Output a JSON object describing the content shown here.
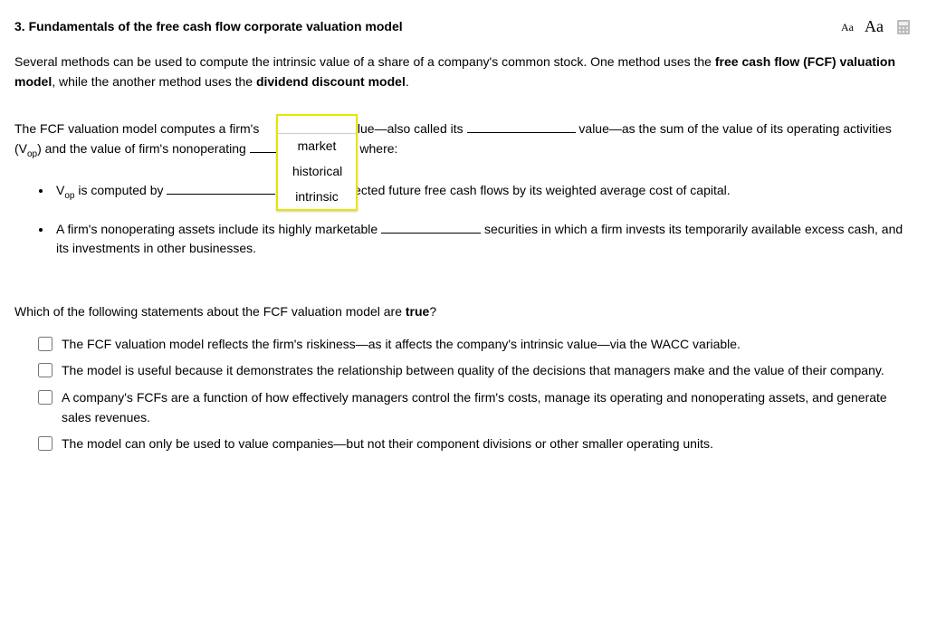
{
  "header": {
    "title": "3.  Fundamentals of the free cash flow corporate valuation model",
    "font_small": "Aa",
    "font_large": "Aa"
  },
  "intro": {
    "pre": "Several methods can be used to compute the intrinsic value of a share of a company's common stock. One method uses the ",
    "bold1": "free cash flow (FCF) valuation model",
    "mid": ", while the another method uses the ",
    "bold2": "dividend discount model",
    "post": "."
  },
  "para": {
    "seg1": "The FCF valuation model computes a firm's ",
    "seg2": " value—also called its ",
    "seg3": " value—as the sum of the value of its operating activities (V",
    "seg3_sub": "op",
    "seg3b": ") and the value of firm's nonoperating ",
    "seg4": " , where:"
  },
  "dropdown": {
    "options": [
      "market",
      "historical",
      "intrinsic"
    ]
  },
  "bullets": {
    "b1_a": "V",
    "b1_sub": "op",
    "b1_b": " is computed by ",
    "b1_c": " the firm's expected future free cash flows by its weighted average cost of capital.",
    "b2_a": "A firm's nonoperating assets include its highly marketable ",
    "b2_b": " securities in which a firm invests its temporarily available excess cash, and its investments in other businesses."
  },
  "q2": {
    "pre": "Which of the following statements about the FCF valuation model are ",
    "bold": "true",
    "post": "?"
  },
  "options": [
    "The FCF valuation model reflects the firm's riskiness—as it affects the company's intrinsic value—via the WACC variable.",
    "The model is useful because it demonstrates the relationship between quality of the decisions that managers make and the value of their company.",
    "A company's FCFs are a function of how effectively managers control the firm's costs, manage its operating and nonoperating assets, and generate sales revenues.",
    "The model can only be used to value companies—but not their component divisions or other smaller operating units."
  ]
}
